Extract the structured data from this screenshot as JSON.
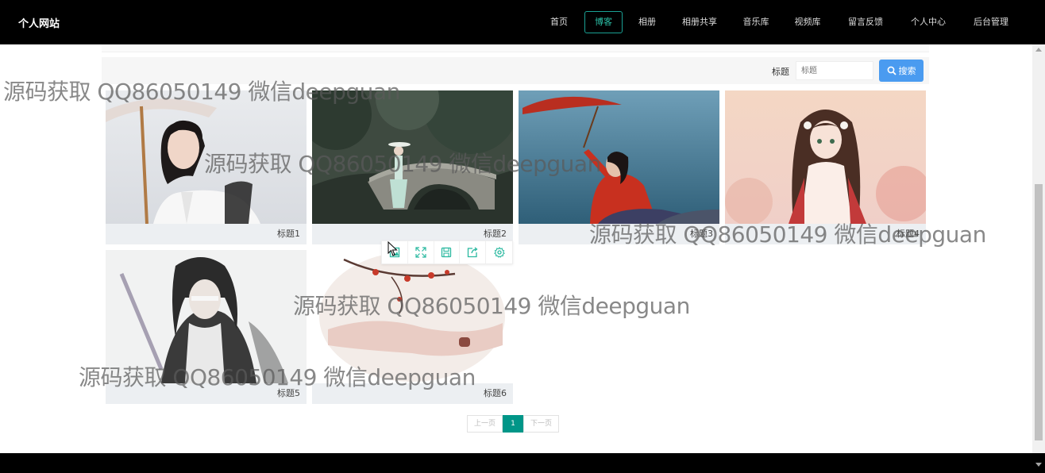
{
  "header": {
    "site_name": "个人网站",
    "nav": [
      {
        "label": "首页",
        "active": false
      },
      {
        "label": "博客",
        "active": true
      },
      {
        "label": "相册",
        "active": false
      },
      {
        "label": "相册共享",
        "active": false
      },
      {
        "label": "音乐库",
        "active": false
      },
      {
        "label": "视频库",
        "active": false
      },
      {
        "label": "留言反馈",
        "active": false
      },
      {
        "label": "个人中心",
        "active": false
      },
      {
        "label": "后台管理",
        "active": false
      }
    ]
  },
  "search": {
    "label": "标题",
    "placeholder": "标题",
    "button_label": "搜索"
  },
  "gallery": {
    "items": [
      {
        "title": "标题1"
      },
      {
        "title": "标题2"
      },
      {
        "title": "标题3"
      },
      {
        "title": "标题4"
      },
      {
        "title": "标题5"
      },
      {
        "title": "标题6"
      }
    ]
  },
  "image_toolbar": {
    "icons": [
      "image-icon",
      "fullscreen-icon",
      "save-icon",
      "share-icon",
      "settings-icon"
    ],
    "color": "#2bb9a0"
  },
  "pagination": {
    "prev_label": "上一页",
    "current_page": "1",
    "next_label": "下一页"
  },
  "watermark": {
    "text": "源码获取 QQ86050149 微信deepguan"
  },
  "colors": {
    "accent": "#009688",
    "search_button": "#4a9bf0",
    "nav_active": "#2bbfa6"
  }
}
